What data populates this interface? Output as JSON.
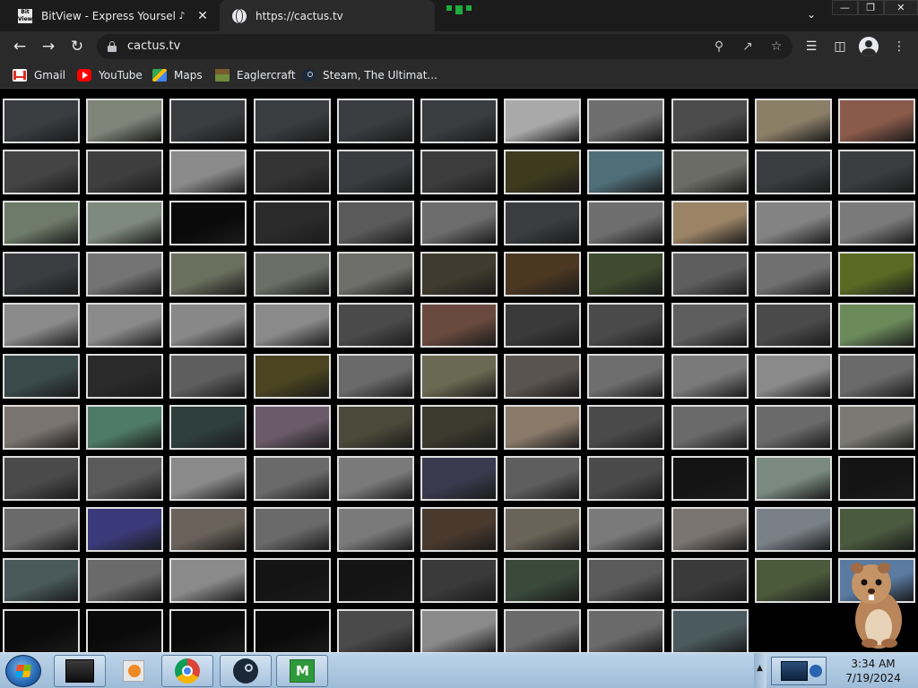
{
  "browser": {
    "tabs": [
      {
        "title": "BitView - Express Yourself.",
        "favicon_text": "Bit\nView",
        "active": false,
        "audio": true
      },
      {
        "title": "https://cactus.tv",
        "active": true,
        "audio": false
      }
    ],
    "url": "cactus.tv",
    "bookmarks": [
      {
        "label": "Gmail",
        "icon": "gmail-icon"
      },
      {
        "label": "YouTube",
        "icon": "youtube-icon"
      },
      {
        "label": "Maps",
        "icon": "maps-icon"
      },
      {
        "label": "Eaglercraft",
        "icon": "eaglercraft-icon"
      },
      {
        "label": "Steam, The Ultimat...",
        "icon": "steam-icon"
      }
    ]
  },
  "camera_grid": {
    "columns": 11,
    "rows": [
      [
        "#3a3c3f",
        "#7f8378",
        "#3a3c3f",
        "#3a3c3f",
        "#3a3c3f",
        "#3a3c3f",
        "#a9a9a9",
        "#6e6e6e",
        "#4b4b4b",
        "#8c7f68",
        "#8a5a4a"
      ],
      [
        "#444444",
        "#3e3e3e",
        "#8a8a8a",
        "#333333",
        "#3a3c3f",
        "#3c3c3c",
        "#3f3a1e",
        "#4f6e78",
        "#6c6c66",
        "#3a3c3f",
        "#3a3c3f"
      ],
      [
        "#6f7b6a",
        "#7f8a7e",
        "#0a0a0a",
        "#2a2a2a",
        "#5a5a5a",
        "#6c6c6c",
        "#3a3c3f",
        "#6e6e6e",
        "#9b8466",
        "#838383",
        "#7a7a7a"
      ],
      [
        "#3a3c3f",
        "#747474",
        "#6b6f5e",
        "#6a6e66",
        "#6e6e6a",
        "#3f3b2e",
        "#4b3722",
        "#3f4a2e",
        "#5e5e5e",
        "#707070",
        "#5a6a22"
      ],
      [
        "#8a8a8a",
        "#8a8a8a",
        "#888888",
        "#8a8a8a",
        "#4a4a4a",
        "#6a4a3e",
        "#3a3a3a",
        "#4a4a4a",
        "#5e5e5e",
        "#4a4a4a",
        "#6a8a5a"
      ],
      [
        "#3a4a4a",
        "#2a2a2a",
        "#5e5e5e",
        "#4a4420",
        "#6a6a6a",
        "#6a6a52",
        "#5a5450",
        "#6e6e6e",
        "#7a7a7a",
        "#8a8a8a",
        "#6a6a6a"
      ],
      [
        "#7a7470",
        "#4e7a68",
        "#2e3e3c",
        "#6a5a6a",
        "#4a4a3a",
        "#3a3a2e",
        "#8a7a6a",
        "#4a4a4a",
        "#6a6a6a",
        "#6a6a6a",
        "#7a7a72"
      ],
      [
        "#4a4a4a",
        "#5a5a5a",
        "#8a8a8a",
        "#6a6a6a",
        "#7a7a7a",
        "#3a3a4e",
        "#5e5e5e",
        "#4a4a4a",
        "#141414",
        "#7a8a82",
        "#141414"
      ],
      [
        "#6a6a6a",
        "#3a3a7a",
        "#6a625a",
        "#6a6a6a",
        "#7a7a7a",
        "#4a3a2e",
        "#6a6458",
        "#7a7a7a",
        "#7a7470",
        "#7a8088",
        "#4a5a3e"
      ],
      [
        "#4a5a5a",
        "#6a6a6a",
        "#8a8a8a",
        "#141414",
        "#141414",
        "#3a3a3a",
        "#3a4a3a",
        "#5a5a5a",
        "#3a3a3a",
        "#4a5a3a",
        "#5a7aa0"
      ],
      [
        "#0a0a0a",
        "#0a0a0a",
        "#0a0a0a",
        "#0a0a0a",
        "#4a4a4a",
        "#8a8a8a",
        "#6a6a6a",
        "#6a6a6a",
        "#4a5a5e"
      ]
    ]
  },
  "taskbar": {
    "apps": [
      {
        "name": "dark-app-icon"
      },
      {
        "name": "media-player-icon"
      },
      {
        "name": "chrome-icon"
      },
      {
        "name": "steam-icon"
      },
      {
        "name": "malwarebytes-icon"
      }
    ],
    "time": "3:34 AM",
    "date": "7/19/2024"
  }
}
